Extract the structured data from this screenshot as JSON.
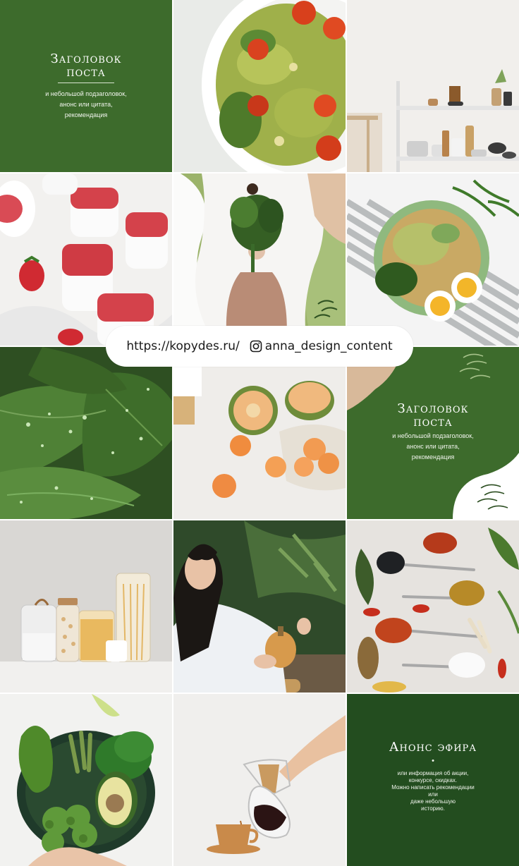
{
  "tiles": {
    "post1": {
      "title_line1": "Заголовок",
      "title_line2": "поста",
      "subtitle_line1": "и небольшой подзаголовок,",
      "subtitle_line2": "анонс или цитата,",
      "subtitle_line3": "рекомендация"
    },
    "post2": {
      "title_line1": "Заголовок",
      "title_line2": "поста",
      "subtitle_line1": "и небольшой подзаголовок,",
      "subtitle_line2": "анонс или цитата,",
      "subtitle_line3": "рекомендация"
    },
    "live": {
      "title": "Анонс эфира",
      "bullet": "•",
      "body_line1": "или информация об акции,",
      "body_line2": "конкурсе, скидках.",
      "body_line3": "Можно написать рекомендации",
      "body_line4": "или",
      "body_line5": "даже небольшую",
      "body_line6": "историю."
    }
  },
  "banner": {
    "url": "https://kopydes.ru/",
    "instagram_handle": "anna_design_content",
    "icon": "instagram-icon"
  },
  "colors": {
    "green": "#3d6b2c",
    "dark_green": "#234d1f",
    "sage": "#9bb36a"
  }
}
